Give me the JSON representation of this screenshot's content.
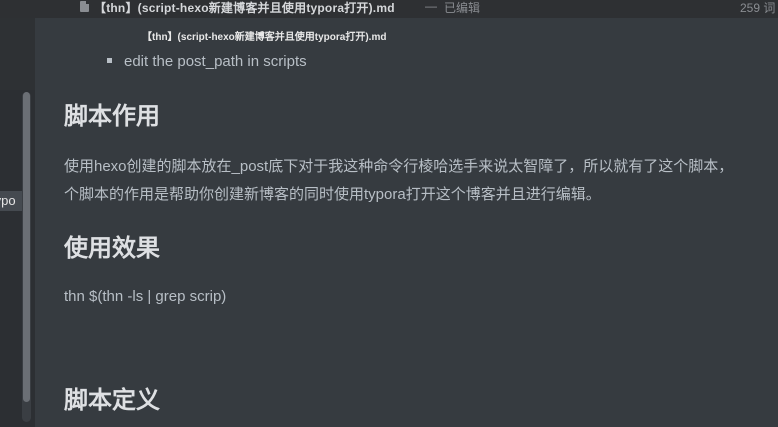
{
  "titlebar": {
    "file_icon": "document-icon",
    "title": "【thn】(script-hexo新建博客并且使用typora打开).md",
    "separator": "—",
    "status": "已编辑",
    "word_count": "259 词"
  },
  "tooltip": {
    "text": "【thn】(script-hexo新建博客并且使用typora打开).md"
  },
  "sidebar": {
    "active_item": "typo"
  },
  "document": {
    "bullet": "edit the post_path in scripts",
    "heading_purpose": "脚本作用",
    "para_line1": "使用hexo创建的脚本放在_post底下对于我这种命令行棱哈选手来说太智障了，所以就有了这个脚本，",
    "para_line2": "个脚本的作用是帮助你创建新博客的同时使用typora打开这个博客并且进行编辑。",
    "heading_effect": "使用效果",
    "command": "thn $(thn -ls | grep scrip)",
    "heading_definition": "脚本定义"
  }
}
